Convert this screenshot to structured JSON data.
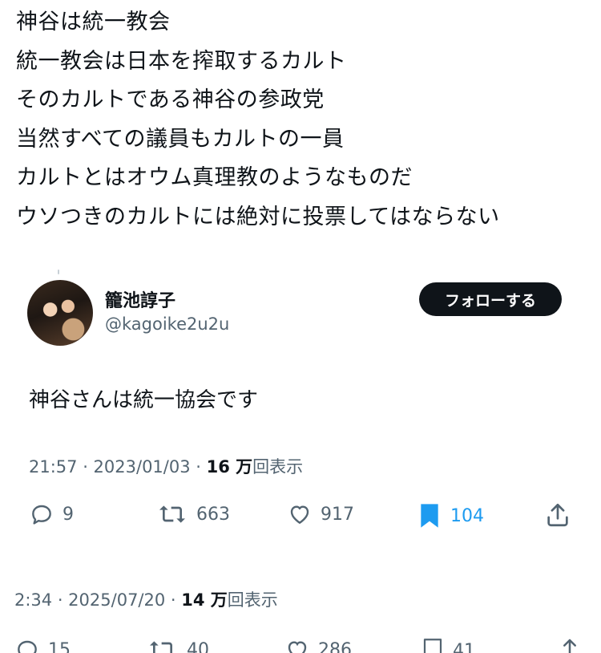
{
  "poem": {
    "lines": [
      "神谷は統一教会",
      "統一教会は日本を搾取するカルト",
      "そのカルトである神谷の参政党",
      "当然すべての議員もカルトの一員",
      "カルトとはオウム真理教のようなものだ",
      "ウソつきのカルトには絶対に投票してはならない"
    ]
  },
  "embedded_tweet": {
    "display_name": "籠池諄子",
    "handle": "@kagoike2u2u",
    "follow_label": "フォローする",
    "text": "神谷さんは統一協会です",
    "time_date": "21:57 · 2023/01/03 · ",
    "views_number": "16 万",
    "views_label": "回表示",
    "actions": {
      "reply": "9",
      "retweet": "663",
      "like": "917",
      "bookmark": "104"
    },
    "colors": {
      "bookmark_active": "#1d9bf0"
    }
  },
  "outer_tweet": {
    "time_date": "2:34 · 2025/07/20 · ",
    "views_number": "14 万",
    "views_label": "回表示",
    "actions": {
      "reply": "15",
      "retweet": "40",
      "like": "286",
      "bookmark": "41"
    }
  }
}
